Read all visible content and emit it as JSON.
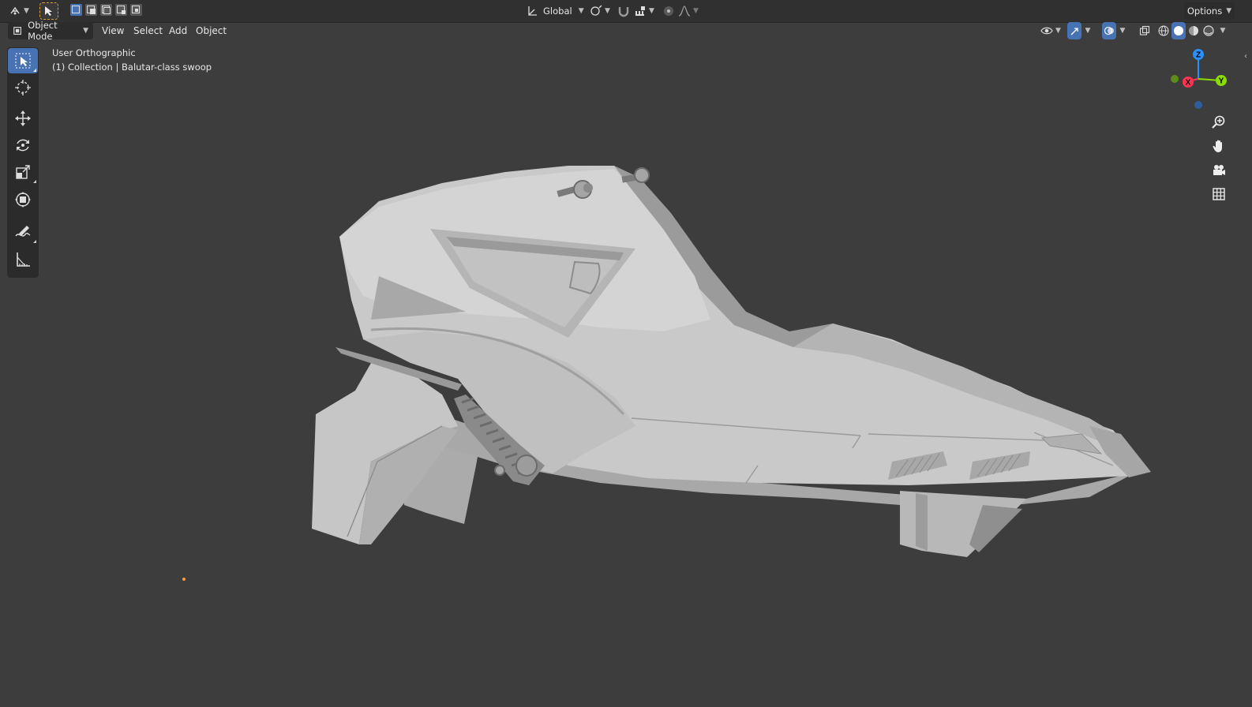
{
  "header": {
    "editor_type_icon": "editor-type-icon",
    "transform_orientation": {
      "value": "Global"
    },
    "options_label": "Options"
  },
  "viewport_header": {
    "mode": {
      "value": "Object Mode"
    },
    "menus": [
      "View",
      "Select",
      "Add",
      "Object"
    ]
  },
  "viewport": {
    "view_name": "User Orthographic",
    "collection_info": "(1) Collection | Balutar-class swoop"
  },
  "toolbar": {
    "tools": [
      "select-box-icon",
      "cursor-icon",
      "move-icon",
      "rotate-icon",
      "scale-icon",
      "transform-icon",
      "annotate-icon",
      "measure-icon"
    ]
  },
  "gizmo": {
    "axis_x": "X",
    "axis_y": "Y",
    "axis_z": "Z",
    "colors": {
      "x": "#ff3352",
      "y": "#8bdc00",
      "z": "#2890ff"
    }
  },
  "navigation": [
    "zoom-icon",
    "pan-hand-icon",
    "camera-icon",
    "grid-icon"
  ],
  "theme": {
    "viewport_bg": "#3d3d3d",
    "header_bg": "#303030",
    "accent": "#4772b3",
    "model_color": "#c8c8c8"
  }
}
